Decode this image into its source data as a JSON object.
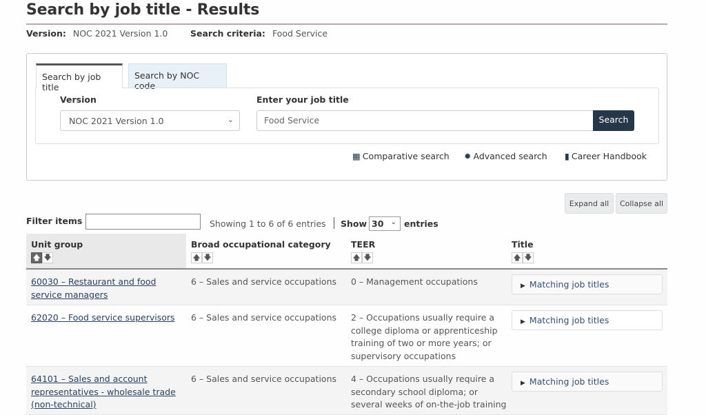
{
  "page": {
    "title": "Search by job title - Results",
    "version_label": "Version:",
    "version_value": "NOC 2021 Version 1.0",
    "criteria_label": "Search criteria:",
    "criteria_value": "Food Service"
  },
  "search_panel": {
    "tabs": [
      {
        "label": "Search by job title",
        "active": true
      },
      {
        "label": "Search by NOC code",
        "active": false
      }
    ],
    "version_field_label": "Version",
    "version_selected": "NOC 2021 Version 1.0",
    "job_title_label": "Enter your job title",
    "job_title_value": "Food Service",
    "search_button": "Search",
    "links": [
      {
        "label": "Comparative search",
        "icon": "grid-icon"
      },
      {
        "label": "Advanced search",
        "icon": "gear-icon"
      },
      {
        "label": "Career Handbook",
        "icon": "book-icon"
      }
    ]
  },
  "results": {
    "expand_all": "Expand all",
    "collapse_all": "Collapse all",
    "filter_label": "Filter items",
    "filter_value": "",
    "showing_text": "Showing 1 to 6 of 6 entries",
    "show_label": "Show",
    "show_value": "30",
    "entries_label": "entries",
    "sort_up": "🡅",
    "sort_down": "🡇",
    "columns": [
      "Unit group",
      "Broad occupational category",
      "TEER",
      "Title"
    ],
    "rows": [
      {
        "unit_group": "60030 – Restaurant and food service managers",
        "category": "6 – Sales and service occupations",
        "teer": "0 – Management occupations",
        "title_button": "Matching job titles"
      },
      {
        "unit_group": "62020 – Food service supervisors",
        "category": "6 – Sales and service occupations",
        "teer": "2 – Occupations usually require a college diploma or apprenticeship training of two or more years; or supervisory occupations",
        "title_button": "Matching job titles"
      },
      {
        "unit_group": "64101 – Sales and account representatives - wholesale trade (non-technical)",
        "category": "6 – Sales and service occupations",
        "teer": "4 – Occupations usually require a secondary school diploma; or several weeks of on-the-job training",
        "title_button": "Matching job titles"
      }
    ]
  }
}
